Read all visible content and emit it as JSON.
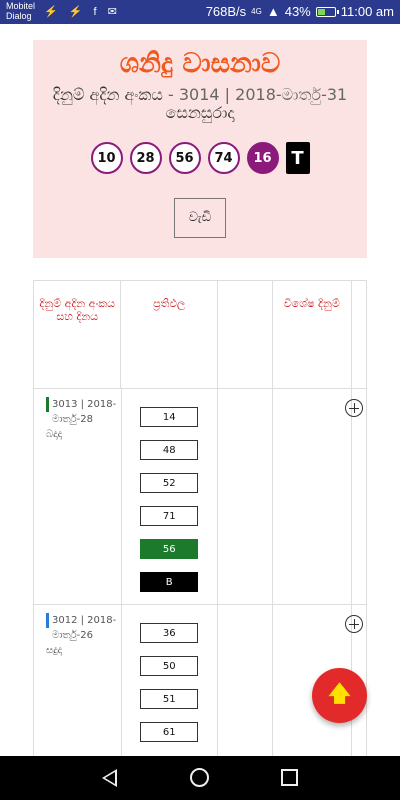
{
  "status": {
    "carrier_line1": "Mobitel",
    "carrier_line2": "Dialog",
    "left_icons": "⚡ ⚡ f ✉",
    "speed": "768B/s",
    "network": "4G",
    "battery": "43%",
    "battery_level": 0.43,
    "time": "11:00 am"
  },
  "header": {
    "title": "ශනිදු වාසනාව",
    "draw_label": "දිනුම් අදින අංකය",
    "draw_number": " - 3014 | 2018-මාර්තු-31",
    "day": "සෙනසුරාදා",
    "balls": [
      "10",
      "28",
      "56",
      "74"
    ],
    "special_ball": "16",
    "letter": "T",
    "more_button": "වැඩි"
  },
  "table": {
    "columns": [
      "දිනුම් අදින අංකය සහ දිනය",
      "ප්‍රතිඵල",
      "",
      "විශේෂ දිනුම්",
      ""
    ],
    "rows": [
      {
        "draw_info": "3013 | 2018-මාර්තු-28",
        "day": "බදාදා",
        "bar_color": "#1c7a2c",
        "numbers": [
          "14",
          "48",
          "52",
          "71"
        ],
        "special": "56",
        "letter": "B"
      },
      {
        "draw_info": "3012 | 2018-මාර්තු-26",
        "day": "සදුදා",
        "bar_color": "#2a7ad8",
        "numbers": [
          "36",
          "50",
          "51",
          "61"
        ]
      }
    ]
  },
  "fab": {
    "icon": "arrow-up-icon"
  }
}
